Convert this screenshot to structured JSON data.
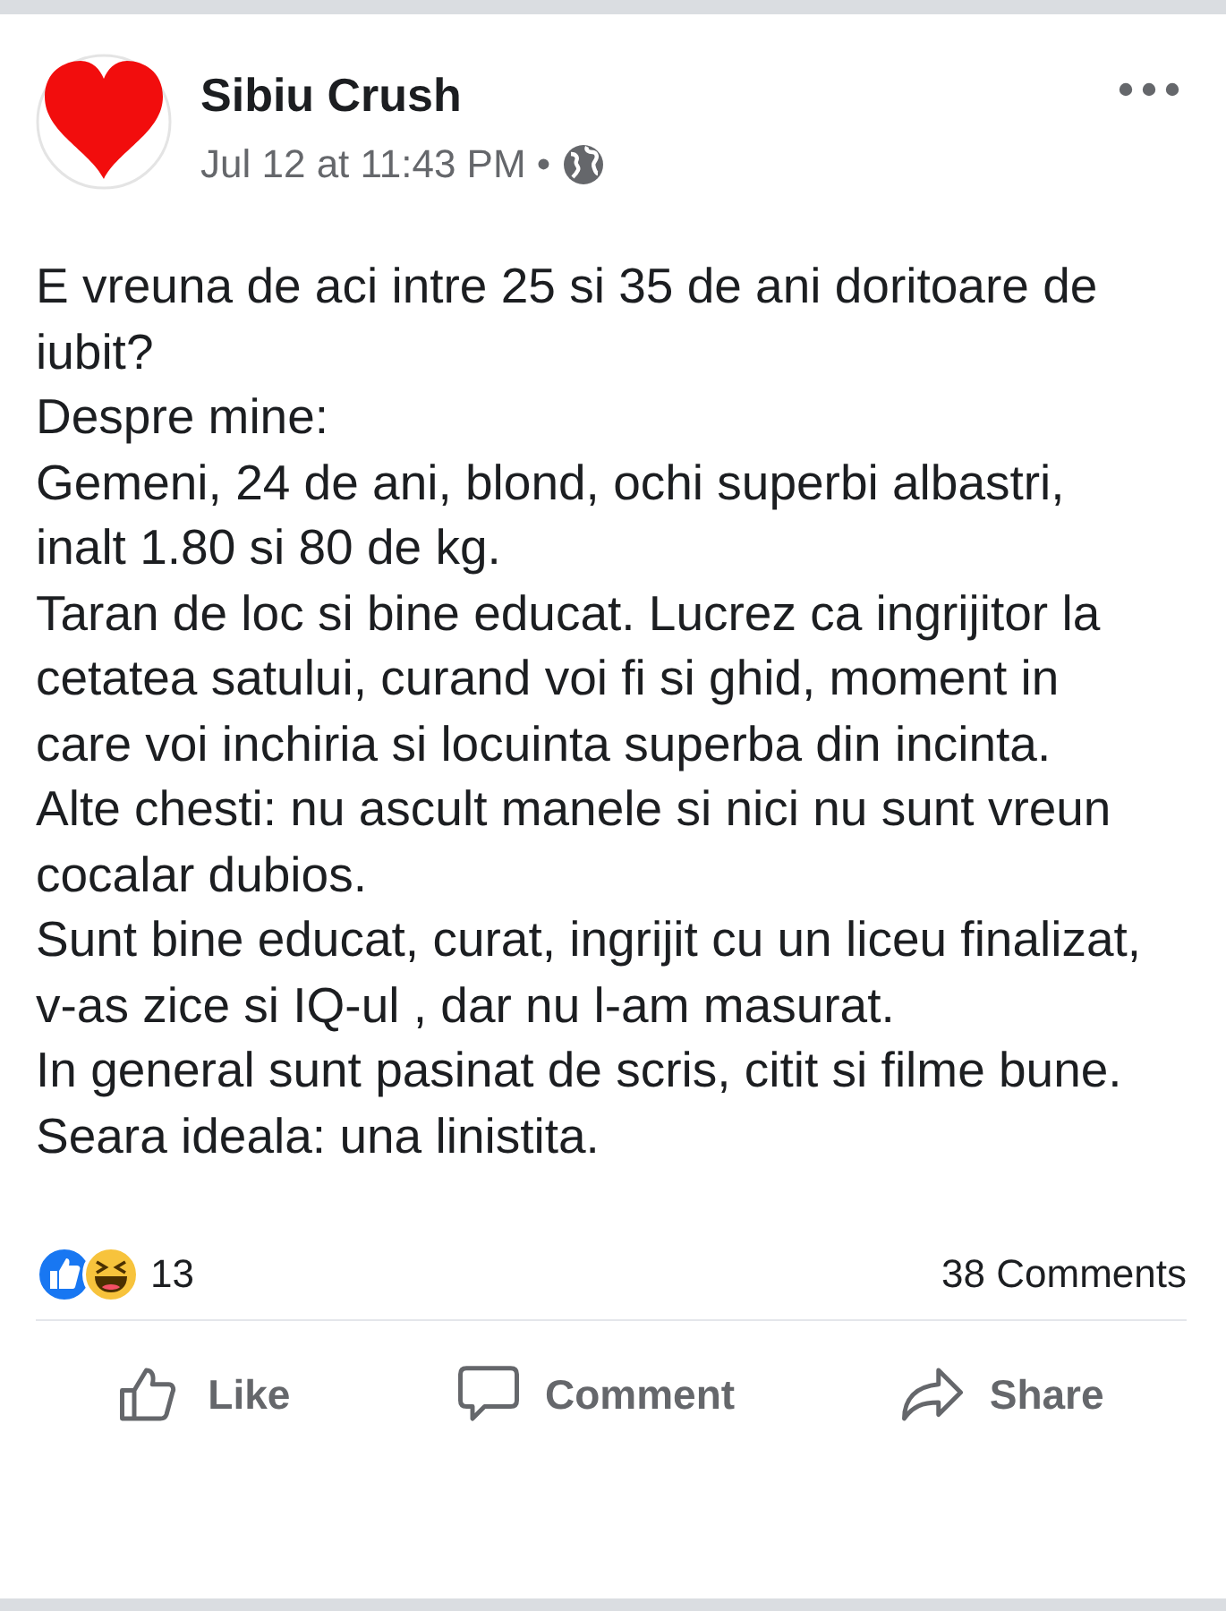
{
  "post": {
    "author": "Sibiu Crush",
    "timestamp": "Jul 12 at 11:43 PM",
    "separator": "•",
    "paragraphs": [
      "E vreuna de aci intre 25 si 35 de ani doritoare de iubit?",
      "Despre mine:",
      "Gemeni, 24 de ani, blond, ochi superbi albastri, inalt 1.80 si 80 de kg.",
      "Taran de loc si bine educat. Lucrez ca ingrijitor la cetatea satului, curand voi fi si ghid, moment in care voi inchiria si locuinta superba din incinta.",
      "Alte chesti: nu ascult manele si nici nu sunt vreun cocalar dubios.",
      "Sunt bine educat, curat, ingrijit cu un liceu finalizat, v-as zice si IQ-ul , dar nu l-am masurat.",
      "In general sunt pasinat de scris, citit si filme bune. Seara ideala: una linistita."
    ],
    "reaction_count": "13",
    "comment_count": "38 Comments",
    "actions": [
      {
        "kind": "like",
        "label": "Like"
      },
      {
        "kind": "comment",
        "label": "Comment"
      },
      {
        "kind": "share",
        "label": "Share"
      }
    ]
  }
}
